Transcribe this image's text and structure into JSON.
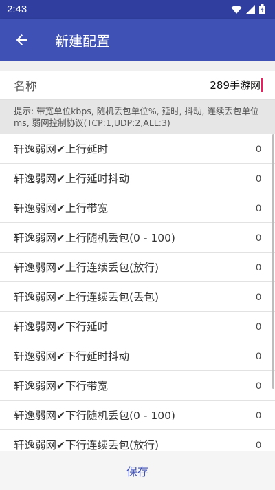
{
  "status": {
    "time": "2:43"
  },
  "appbar": {
    "title": "新建配置"
  },
  "name_row": {
    "label": "名称",
    "value": "289手游网"
  },
  "tip": "提示: 带宽单位kbps, 随机丢包单位%, 延时, 抖动, 连续丢包单位ms, 弱网控制协议(TCP:1,UDP:2,ALL:3)",
  "items": [
    {
      "label": "轩逸弱网✔上行延时",
      "value": "0"
    },
    {
      "label": "轩逸弱网✔上行延时抖动",
      "value": "0"
    },
    {
      "label": "轩逸弱网✔上行带宽",
      "value": "0"
    },
    {
      "label": "轩逸弱网✔上行随机丢包(0 - 100)",
      "value": "0"
    },
    {
      "label": "轩逸弱网✔上行连续丢包(放行)",
      "value": "0"
    },
    {
      "label": "轩逸弱网✔上行连续丢包(丢包)",
      "value": "0"
    },
    {
      "label": "轩逸弱网✔下行延时",
      "value": "0"
    },
    {
      "label": "轩逸弱网✔下行延时抖动",
      "value": "0"
    },
    {
      "label": "轩逸弱网✔下行带宽",
      "value": "0"
    },
    {
      "label": "轩逸弱网✔下行随机丢包(0 - 100)",
      "value": "0"
    },
    {
      "label": "轩逸弱网✔下行连续丢包(放行)",
      "value": "0"
    }
  ],
  "bottom": {
    "save_label": "保存"
  },
  "colors": {
    "primary": "#3f51b5",
    "primary_dark": "#303f9f",
    "cursor": "#e91e63"
  }
}
